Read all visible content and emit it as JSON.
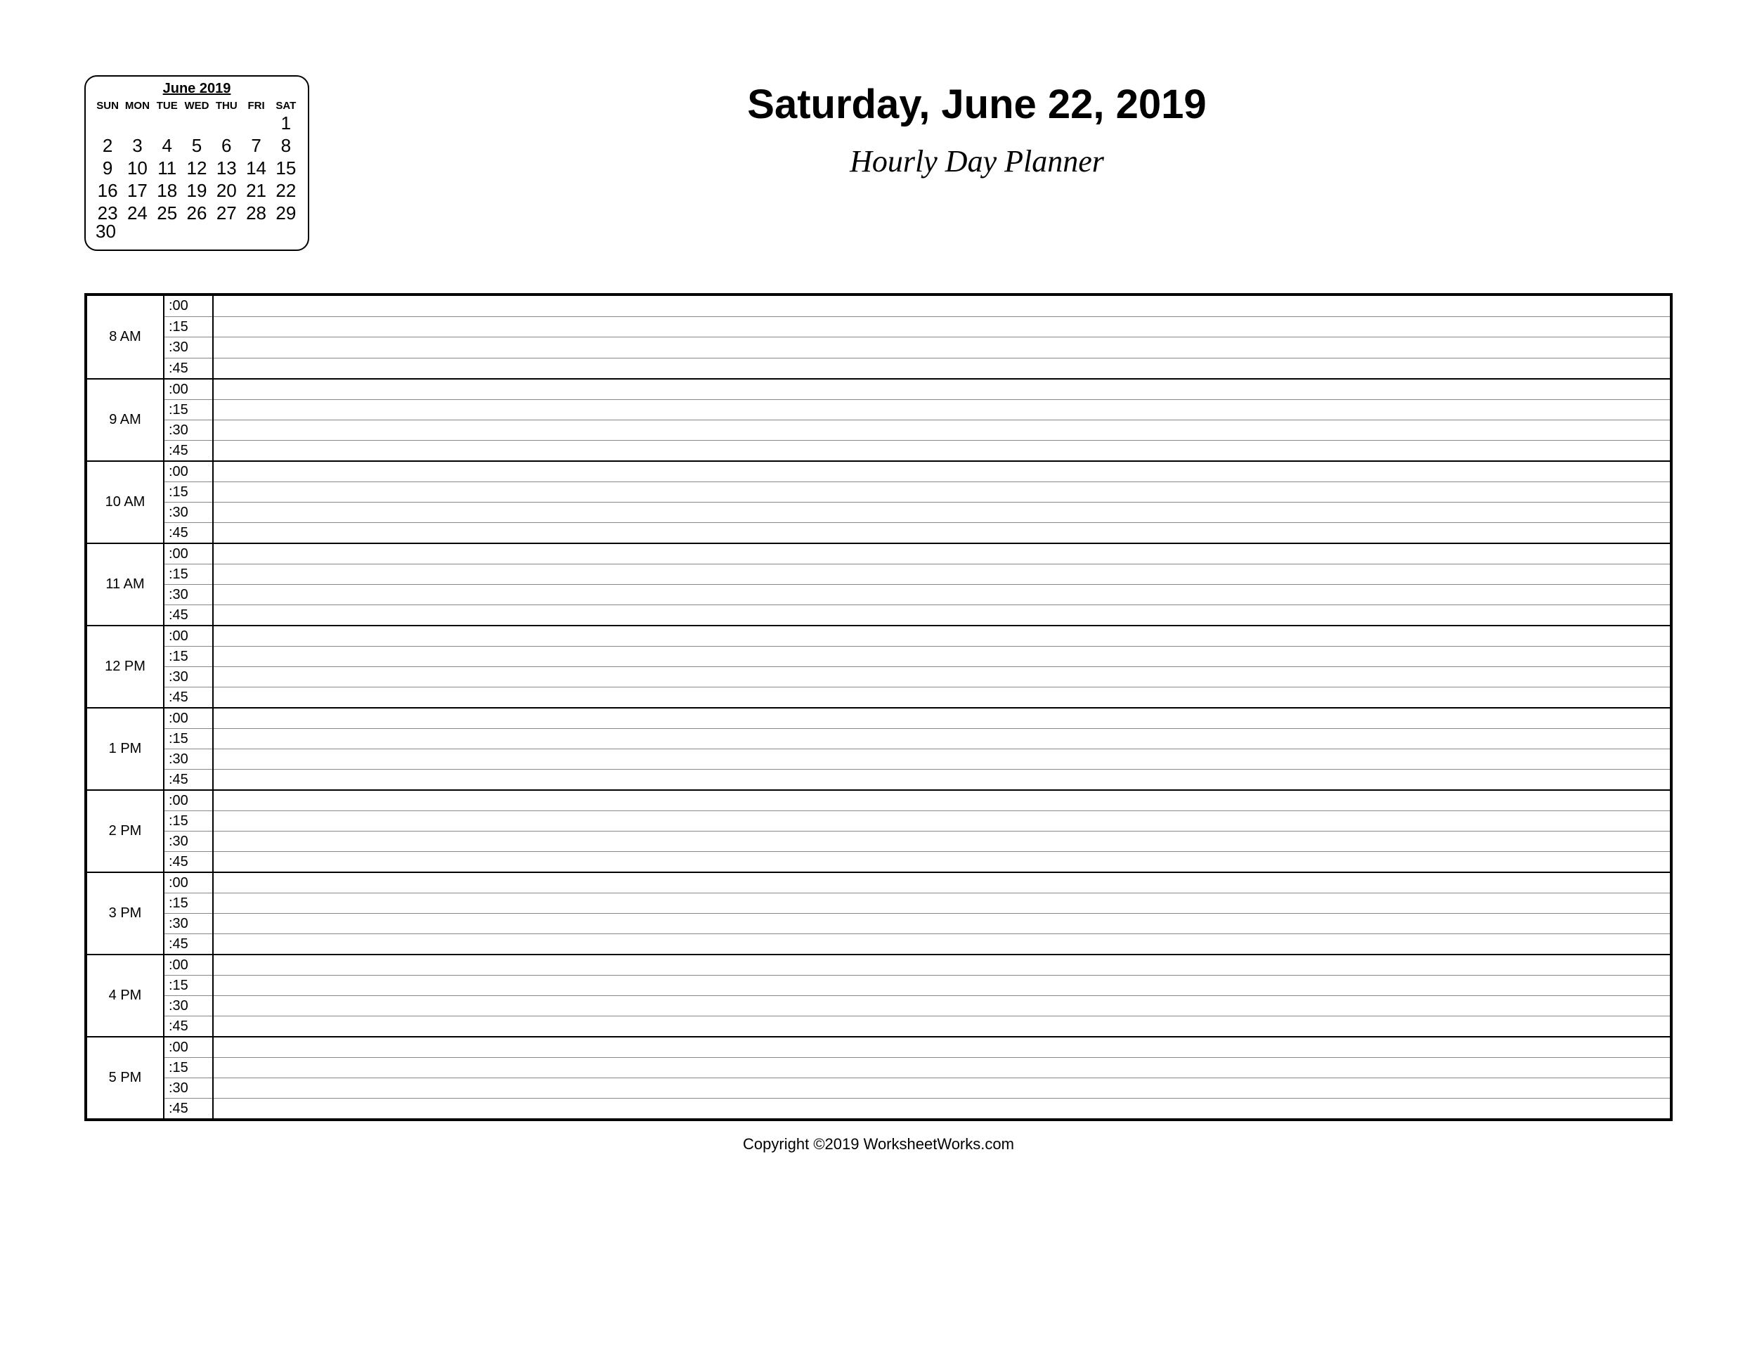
{
  "header": {
    "date_title": "Saturday, June 22, 2019",
    "subtitle": "Hourly Day Planner"
  },
  "mini_calendar": {
    "title": "June 2019",
    "dow": [
      "SUN",
      "MON",
      "TUE",
      "WED",
      "THU",
      "FRI",
      "SAT"
    ],
    "cells": [
      "",
      "",
      "",
      "",
      "",
      "",
      "1",
      "2",
      "3",
      "4",
      "5",
      "6",
      "7",
      "8",
      "9",
      "10",
      "11",
      "12",
      "13",
      "14",
      "15",
      "16",
      "17",
      "18",
      "19",
      "20",
      "21",
      "22",
      "23",
      "24",
      "25",
      "26",
      "27",
      "28",
      "29"
    ],
    "overflow": "30"
  },
  "planner": {
    "hours": [
      "8 AM",
      "9 AM",
      "10 AM",
      "11 AM",
      "12 PM",
      "1 PM",
      "2 PM",
      "3 PM",
      "4 PM",
      "5 PM"
    ],
    "minute_marks": [
      ":00",
      ":15",
      ":30",
      ":45"
    ]
  },
  "footer": "Copyright ©2019 WorksheetWorks.com"
}
